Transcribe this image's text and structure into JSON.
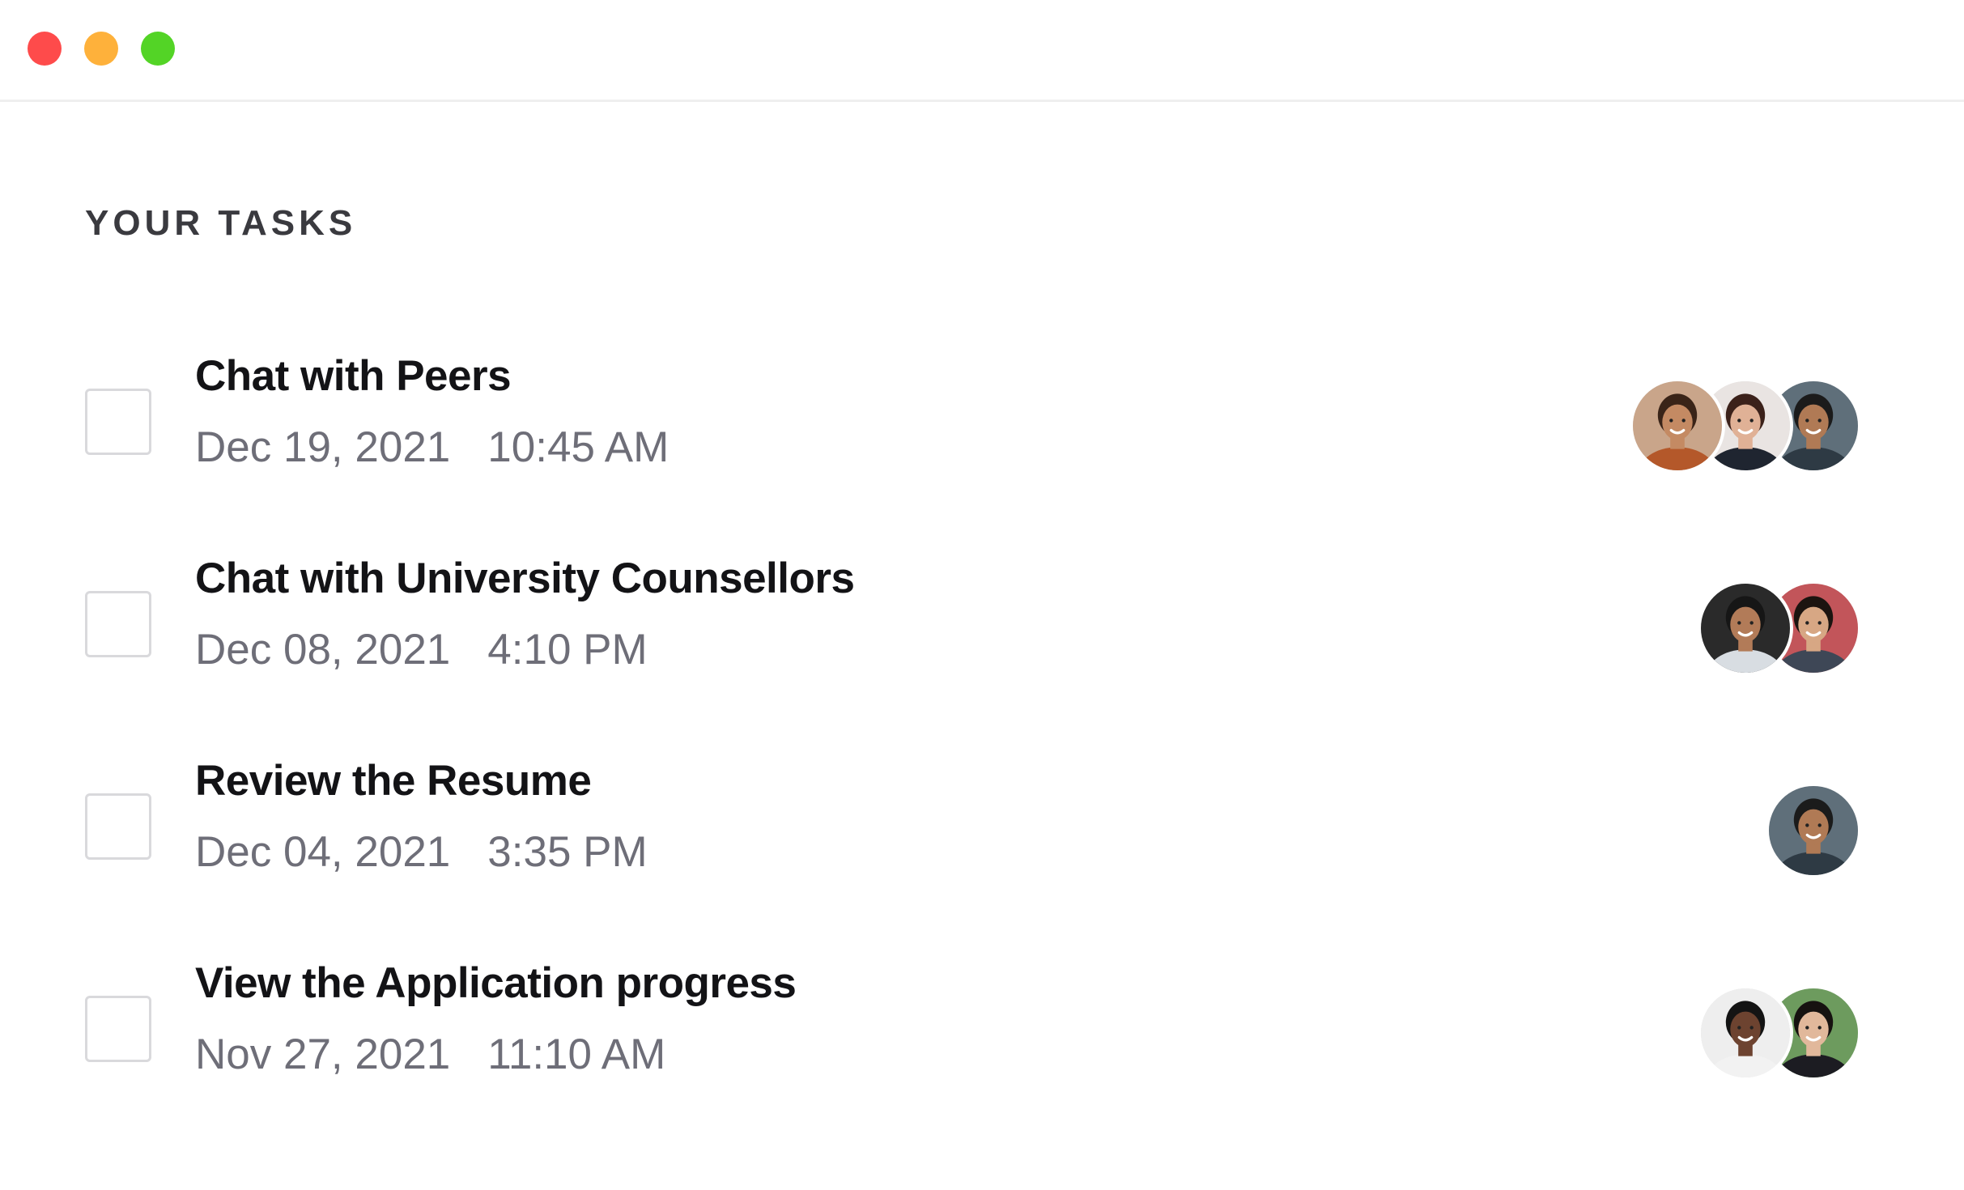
{
  "window": {
    "traffic_lights": {
      "close_color": "#fe4b4b",
      "minimize_color": "#feb13b",
      "zoom_color": "#53d426"
    }
  },
  "section": {
    "title": "YOUR TASKS"
  },
  "tasks": [
    {
      "title": "Chat with Peers",
      "date": "Dec 19, 2021",
      "time": "10:45 AM",
      "checked": false,
      "avatars": [
        {
          "bg": "#c9a58a",
          "skin": "#c48a63",
          "hair": "#3a2418",
          "shirt": "#b4582a"
        },
        {
          "bg": "#e9e4e2",
          "skin": "#e0b196",
          "hair": "#3b211a",
          "shirt": "#1f2530"
        },
        {
          "bg": "#5f6f7a",
          "skin": "#b07a55",
          "hair": "#1b1b1b",
          "shirt": "#2e3a44"
        }
      ]
    },
    {
      "title": "Chat with University Counsellors",
      "date": "Dec 08, 2021",
      "time": "4:10 PM",
      "checked": false,
      "avatars": [
        {
          "bg": "#2a2a2a",
          "skin": "#b27b58",
          "hair": "#161616",
          "shirt": "#d8dde2"
        },
        {
          "bg": "#c2555a",
          "skin": "#d7a784",
          "hair": "#1c1410",
          "shirt": "#3e4756"
        }
      ]
    },
    {
      "title": "Review the Resume",
      "date": "Dec 04, 2021",
      "time": "3:35 PM",
      "checked": false,
      "avatars": [
        {
          "bg": "#5f6f7a",
          "skin": "#b07a55",
          "hair": "#1b1b1b",
          "shirt": "#2e3a44"
        }
      ]
    },
    {
      "title": "View the Application progress",
      "date": "Nov 27, 2021",
      "time": "11:10 AM",
      "checked": false,
      "avatars": [
        {
          "bg": "#eeeeee",
          "skin": "#6d4330",
          "hair": "#141414",
          "shirt": "#f2f2f2"
        },
        {
          "bg": "#6d9b5e",
          "skin": "#e1b89b",
          "hair": "#161210",
          "shirt": "#1c1c22"
        }
      ]
    }
  ],
  "icons": {
    "checkbox": "checkbox-icon",
    "avatar": "user-avatar"
  }
}
